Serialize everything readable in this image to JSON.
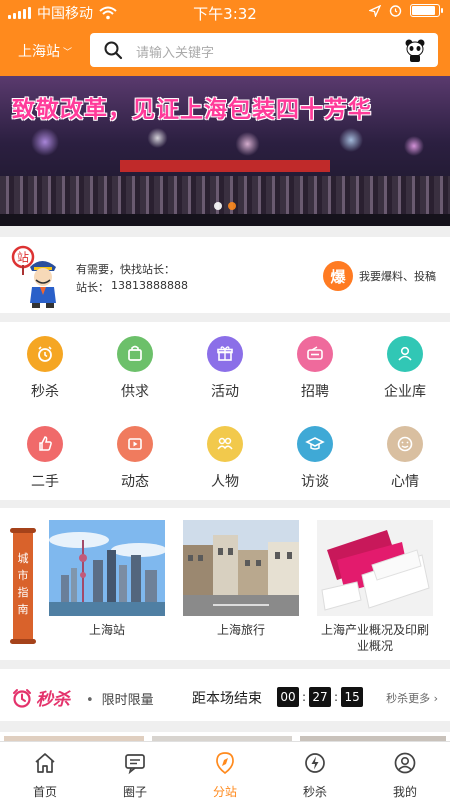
{
  "status_bar": {
    "carrier": "中国移动",
    "time": "下午3:32",
    "battery_level": 0.9
  },
  "header": {
    "city": "上海站",
    "search_placeholder": "请输入关键字"
  },
  "banner": {
    "title": "致敬改革，见证上海包装四十芳华",
    "slide_count": 2,
    "active_slide": 2
  },
  "manager": {
    "line1": "有需要，快找站长：",
    "label": "站长：",
    "phone": "13813888888",
    "report_icon": "爆",
    "report_label": "我要爆料、投稿"
  },
  "grid": [
    {
      "label": "秒杀",
      "icon": "alarm-clock-icon",
      "color": "#f5a623"
    },
    {
      "label": "供求",
      "icon": "bag-icon",
      "color": "#6cc06a"
    },
    {
      "label": "活动",
      "icon": "gift-icon",
      "color": "#8b6fe8"
    },
    {
      "label": "招聘",
      "icon": "radio-icon",
      "color": "#ef6a9c"
    },
    {
      "label": "企业库",
      "icon": "person-icon",
      "color": "#31c7b5"
    },
    {
      "label": "二手",
      "icon": "thumb-icon",
      "color": "#f06a6a"
    },
    {
      "label": "动态",
      "icon": "video-icon",
      "color": "#f07b5e"
    },
    {
      "label": "人物",
      "icon": "people-icon",
      "color": "#f2c94c"
    },
    {
      "label": "访谈",
      "icon": "cap-icon",
      "color": "#3fa9d6"
    },
    {
      "label": "心情",
      "icon": "smile-icon",
      "color": "#d9bfa0"
    }
  ],
  "guide": {
    "tag": [
      "城",
      "市",
      "指",
      "南"
    ],
    "cards": [
      {
        "caption": "上海站"
      },
      {
        "caption": "上海旅行"
      },
      {
        "caption": "上海产业概况及印刷业概况"
      }
    ]
  },
  "flash": {
    "logo": "秒杀",
    "subtitle": "限时限量",
    "countdown_label": "距本场结束",
    "hours": "00",
    "minutes": "27",
    "seconds": "15",
    "more": "秒杀更多 ›"
  },
  "tabs": [
    {
      "label": "首页",
      "icon": "home-icon",
      "active": false
    },
    {
      "label": "圈子",
      "icon": "chat-icon",
      "active": false
    },
    {
      "label": "分站",
      "icon": "compass-icon",
      "active": true
    },
    {
      "label": "秒杀",
      "icon": "lightning-icon",
      "active": false
    },
    {
      "label": "我的",
      "icon": "user-icon",
      "active": false
    }
  ],
  "colors": {
    "accent": "#ff8a1d",
    "flash": "#e4336c"
  }
}
